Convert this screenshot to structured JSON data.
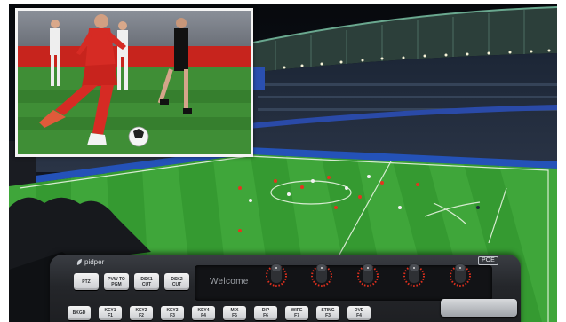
{
  "device": {
    "brand": "pidper",
    "screen_text": "Welcome",
    "badge": "POE",
    "top_row_buttons": [
      {
        "line1": "PTZ",
        "line2": ""
      },
      {
        "line1": "PVW TO",
        "line2": "PGM"
      },
      {
        "line1": "DSK1",
        "line2": "CUT"
      },
      {
        "line1": "DSK2",
        "line2": "CUT"
      }
    ],
    "bottom_row_buttons": [
      {
        "line1": "BKGD",
        "line2": ""
      },
      {
        "line1": "KEY1",
        "line2": "F1"
      },
      {
        "line1": "KEY2",
        "line2": "F2"
      },
      {
        "line1": "KEY3",
        "line2": "F3"
      },
      {
        "line1": "KEY4",
        "line2": "F4"
      },
      {
        "line1": "MIX",
        "line2": "F5"
      },
      {
        "line1": "DIP",
        "line2": "F6"
      },
      {
        "line1": "WIPE",
        "line2": "F7"
      },
      {
        "line1": "STING",
        "line2": "F3"
      },
      {
        "line1": "DVE",
        "line2": "F4"
      }
    ],
    "knob_count": 5
  },
  "colors": {
    "pitch_light": "#3fa63a",
    "pitch_dark": "#2f8a2c",
    "console_body": "#26282c",
    "knob_ring": "#e0301e"
  }
}
